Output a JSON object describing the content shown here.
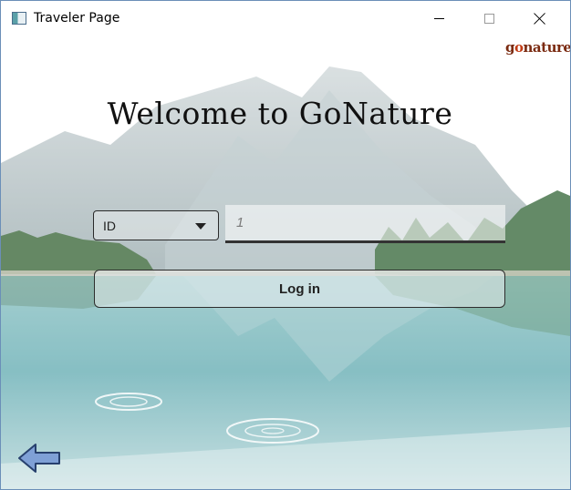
{
  "window": {
    "title": "Traveler Page"
  },
  "logo": {
    "text_prefix": "g",
    "text_o": "o",
    "text_suffix": "nature"
  },
  "main": {
    "headline": "Welcome to GoNature",
    "id_type_select": {
      "selected": "ID"
    },
    "id_input": {
      "value": "",
      "placeholder": "1"
    },
    "login_button_label": "Log in"
  },
  "icons": {
    "back": "back-arrow-icon",
    "app": "app-window-icon"
  },
  "colors": {
    "sky": "#ffffff",
    "lake": "#6fb1b8",
    "mountain": "#8fa3a8",
    "forest": "#3f6b3e",
    "back_arrow": "#5b7fbf",
    "logo": "#7a2a10"
  }
}
